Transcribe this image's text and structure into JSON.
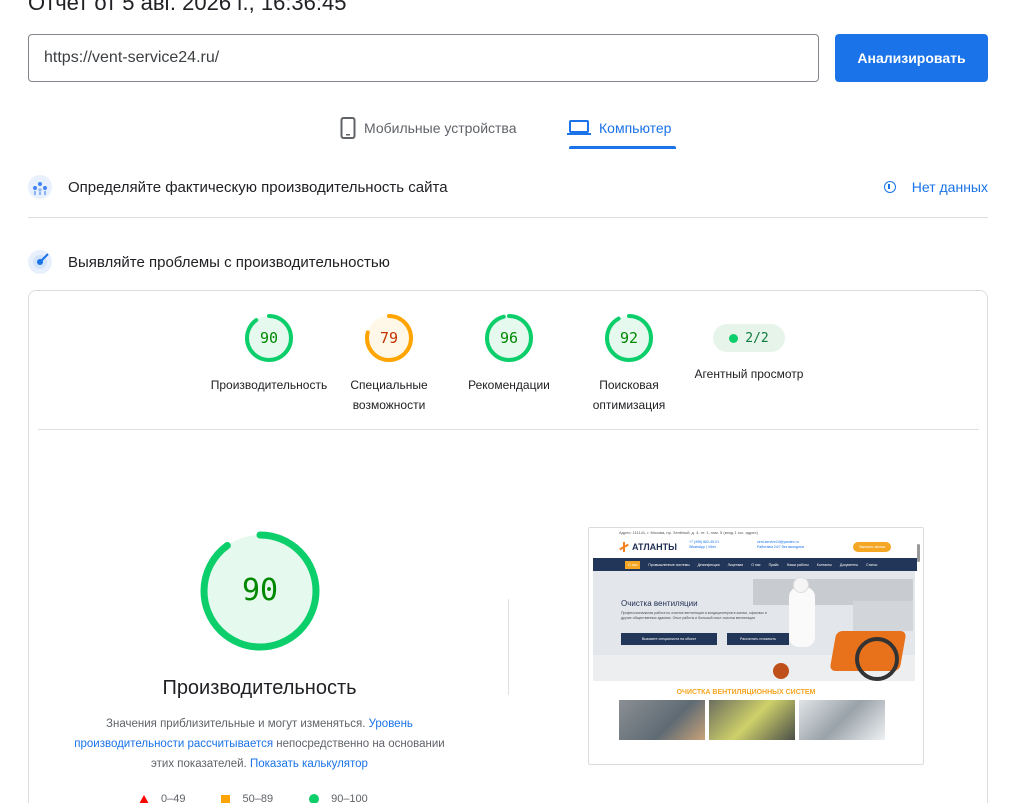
{
  "report": {
    "title": "Отчет от 5 авг. 2026 г., 16:36:45"
  },
  "url_bar": {
    "value": "https://vent-service24.ru/",
    "analyze_label": "Анализировать"
  },
  "tabs": [
    {
      "label": "Мобильные устройства",
      "icon": "smartphone-icon",
      "active": false
    },
    {
      "label": "Компьютер",
      "icon": "laptop-icon",
      "active": true
    }
  ],
  "field_section": {
    "title": "Определяйте фактическую производительность сайта",
    "status": "Нет данных",
    "icon": "field-data-icon"
  },
  "lab_section": {
    "title": "Выявляйте проблемы с производительностью",
    "icon": "lab-data-icon"
  },
  "scores": [
    {
      "value": "90",
      "label": "Производительность",
      "score": 90,
      "rating": "pass"
    },
    {
      "value": "79",
      "label": "Специальные возможности",
      "score": 79,
      "rating": "average"
    },
    {
      "value": "96",
      "label": "Рекомендации",
      "score": 96,
      "rating": "pass"
    },
    {
      "value": "92",
      "label": "Поисковая оптимизация",
      "score": 92,
      "rating": "pass"
    }
  ],
  "agent": {
    "value": "2/2",
    "label": "Агентный просмотр"
  },
  "performance": {
    "score": "90",
    "score_fraction": 0.9,
    "title": "Производительность",
    "desc_part1": "Значения приблизительные и могут изменяться. ",
    "desc_link1": "Уровень производительности рассчитывается",
    "desc_part2": " непосредственно на основании этих показателей. ",
    "desc_link2": "Показать калькулятор"
  },
  "legend": [
    {
      "range": "0–49",
      "shape": "triangle",
      "color": "#ff0000"
    },
    {
      "range": "50–89",
      "shape": "square",
      "color": "#ffa400"
    },
    {
      "range": "90–100",
      "shape": "circle",
      "color": "#0cce6b"
    }
  ],
  "screenshot": {
    "topbar": "Адрес: 111141, г. Москва, пр. Зелёный, д. 4, эт. 1, пом. 5 (вход 1 гос. адрес)",
    "logo": "АТЛАНТЫ",
    "contact_phone": "+7 (495) 662-49-01",
    "contact_note": "WhatsApp | Viber",
    "contact_email": "vent-service24@yandex.ru",
    "contact_hours": "Работаем 24/7 без выходных",
    "call_button": "Заказать звонок",
    "nav": [
      "О нас",
      "Промышленные системы",
      "Дезинфекция",
      "Лицензии",
      "О нас",
      "Прайс",
      "Наши работы",
      "Контакты",
      "Документы",
      "Статьи"
    ],
    "hero_title": "Очистка вентиляции",
    "hero_text": "Профессиональная работа по очистке вентиляции и кондиционеров в жилых, офисных и других общественных зданиях. Опыт работы и большой опыт очистки вентиляции",
    "hero_btn1": "Вызовите специалиста на объект",
    "hero_btn2": "Рассчитать стоимость",
    "section_heading": "ОЧИСТКА ВЕНТИЛЯЦИОННЫХ СИСТЕМ"
  },
  "colors": {
    "accent": "#1a73e8",
    "pass": "#0cce6b",
    "pass_text": "#008800",
    "average": "#ffa400",
    "average_text": "#c33300",
    "fail": "#ff0000"
  }
}
